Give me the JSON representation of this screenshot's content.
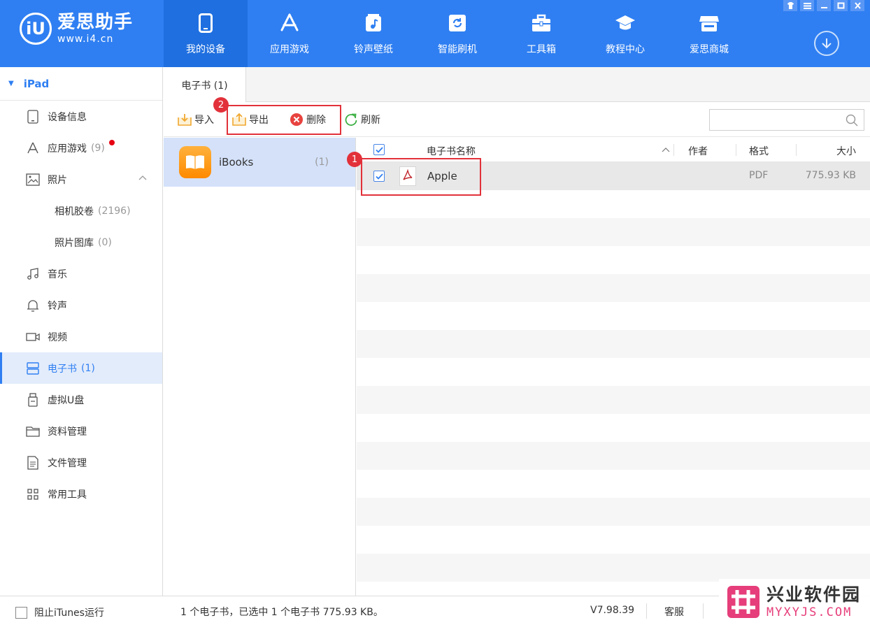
{
  "app": {
    "logo_mark": "iU",
    "name": "爱思助手",
    "url": "www.i4.cn"
  },
  "nav": [
    {
      "label": "我的设备",
      "icon": "phone-icon",
      "active": true
    },
    {
      "label": "应用游戏",
      "icon": "app-store-icon",
      "active": false
    },
    {
      "label": "铃声壁纸",
      "icon": "music-note-icon",
      "active": false
    },
    {
      "label": "智能刷机",
      "icon": "refresh-box-icon",
      "active": false
    },
    {
      "label": "工具箱",
      "icon": "toolbox-icon",
      "active": false
    },
    {
      "label": "教程中心",
      "icon": "graduation-cap-icon",
      "active": false
    },
    {
      "label": "爱思商城",
      "icon": "store-icon",
      "active": false
    }
  ],
  "window_controls": [
    "skin-icon",
    "menu-icon",
    "minimize-icon",
    "maximize-icon",
    "close-icon"
  ],
  "sidebar": {
    "device": "iPad",
    "items": [
      {
        "label": "设备信息",
        "count": "",
        "icon": "tablet-icon"
      },
      {
        "label": "应用游戏",
        "count": "(9)",
        "icon": "app-store-icon",
        "has_dot": true
      },
      {
        "label": "照片",
        "count": "",
        "icon": "image-icon",
        "expanded": true
      },
      {
        "label": "相机胶卷",
        "count": "(2196)",
        "sub": true
      },
      {
        "label": "照片图库",
        "count": "(0)",
        "sub": true
      },
      {
        "label": "音乐",
        "count": "",
        "icon": "music-icon"
      },
      {
        "label": "铃声",
        "count": "",
        "icon": "bell-icon"
      },
      {
        "label": "视频",
        "count": "",
        "icon": "video-icon"
      },
      {
        "label": "电子书",
        "count": "(1)",
        "icon": "ebook-icon",
        "active": true
      },
      {
        "label": "虚拟U盘",
        "count": "",
        "icon": "usb-icon"
      },
      {
        "label": "资料管理",
        "count": "",
        "icon": "folder-icon"
      },
      {
        "label": "文件管理",
        "count": "",
        "icon": "file-icon"
      },
      {
        "label": "常用工具",
        "count": "",
        "icon": "grid-icon"
      }
    ]
  },
  "tab": {
    "label": "电子书 (1)"
  },
  "toolbar": {
    "import_label": "导入",
    "export_label": "导出",
    "delete_label": "删除",
    "refresh_label": "刷新",
    "search_placeholder": ""
  },
  "annotations": {
    "badge1": "1",
    "badge2": "2",
    "highlight_color": "#e2313a"
  },
  "books": [
    {
      "name": "iBooks",
      "count": "(1)"
    }
  ],
  "table": {
    "columns": {
      "name": "电子书名称",
      "author": "作者",
      "format": "格式",
      "size": "大小"
    },
    "rows": [
      {
        "name": "Apple",
        "author": "",
        "format": "PDF",
        "size": "775.93 KB",
        "checked": true
      }
    ]
  },
  "status": {
    "block_itunes": "阻止iTunes运行",
    "summary": "1 个电子书，已选中 1 个电子书 775.93 KB。",
    "version": "V7.98.39",
    "service": "客服"
  },
  "watermark": {
    "title": "兴业软件园",
    "url": "MYXYJS.COM"
  },
  "colors": {
    "brand": "#2f7ff2",
    "active_nav": "#1f6fe0",
    "selected_row": "#d4e1f9",
    "accent_red": "#e2313a"
  }
}
